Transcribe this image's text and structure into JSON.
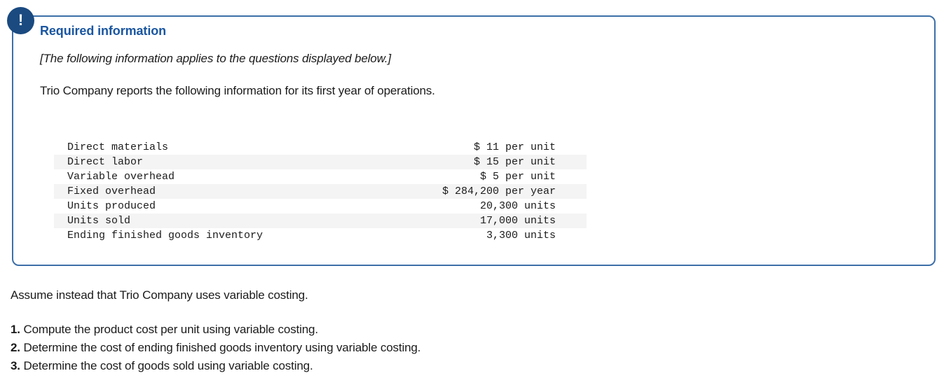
{
  "callout": {
    "icon": "exclamation-icon",
    "icon_glyph": "!",
    "title": "Required information",
    "applies_note": "[The following information applies to the questions displayed below.]",
    "intro": "Trio Company reports the following information for its first year of operations.",
    "border_color": "#3d6fa8",
    "badge_color": "#1a4a80",
    "title_color": "#1a56a0"
  },
  "fact_table": {
    "rows": [
      {
        "label": "Direct materials",
        "value": "$ 11 per unit",
        "striped": false
      },
      {
        "label": "Direct labor",
        "value": "$ 15 per unit",
        "striped": true
      },
      {
        "label": "Variable overhead",
        "value": "$ 5 per unit",
        "striped": false
      },
      {
        "label": "Fixed overhead",
        "value": "$ 284,200 per year",
        "striped": true
      },
      {
        "label": "Units produced",
        "value": "20,300 units",
        "striped": false
      },
      {
        "label": "Units sold",
        "value": "17,000 units",
        "striped": true
      },
      {
        "label": "Ending finished goods inventory",
        "value": "3,300 units",
        "striped": false
      }
    ]
  },
  "lower": {
    "assume_line": "Assume instead that Trio Company uses variable costing.",
    "questions": [
      {
        "num": "1.",
        "text": " Compute the product cost per unit using variable costing."
      },
      {
        "num": "2.",
        "text": " Determine the cost of ending finished goods inventory using variable costing."
      },
      {
        "num": "3.",
        "text": " Determine the cost of goods sold using variable costing."
      }
    ]
  }
}
